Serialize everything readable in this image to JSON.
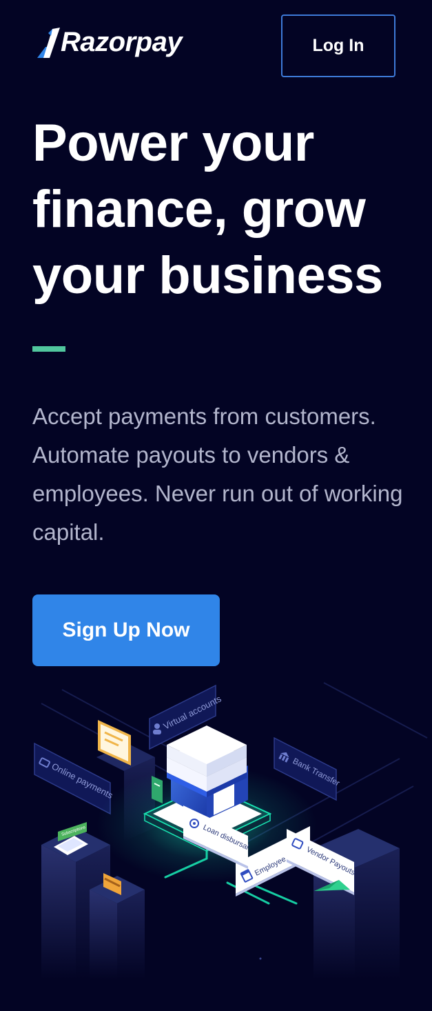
{
  "header": {
    "brand": "Razorpay",
    "login_label": "Log In"
  },
  "hero": {
    "title": "Power your finance, grow your business",
    "subtitle": "Accept payments from customers. Automate payouts to vendors & employees. Never run out of working capital.",
    "cta_label": "Sign Up Now"
  },
  "illustration": {
    "labels": {
      "virtual_accounts": "Virtual accounts",
      "online_payments": "Online payments",
      "bank_transfer": "Bank Transfer",
      "employee_salaries": "Employee Salaries",
      "loan_disbursal": "Loan disbursal",
      "vendor_payouts": "Vendor Payouts",
      "subscriptions": "Subscriptions"
    }
  },
  "colors": {
    "background": "#030424",
    "brand_blue": "#3085e8",
    "login_border": "#3e7bd9",
    "accent_green": "#51c79e",
    "glow_teal": "#19e3b1",
    "subtitle_text": "#b3b6cd"
  },
  "icons": [
    "razorpay-logo-icon",
    "user-icon",
    "card-icon",
    "bank-icon",
    "calendar-icon",
    "wallet-icon",
    "paper-plane-icon",
    "phone-icon",
    "envelope-icon"
  ]
}
